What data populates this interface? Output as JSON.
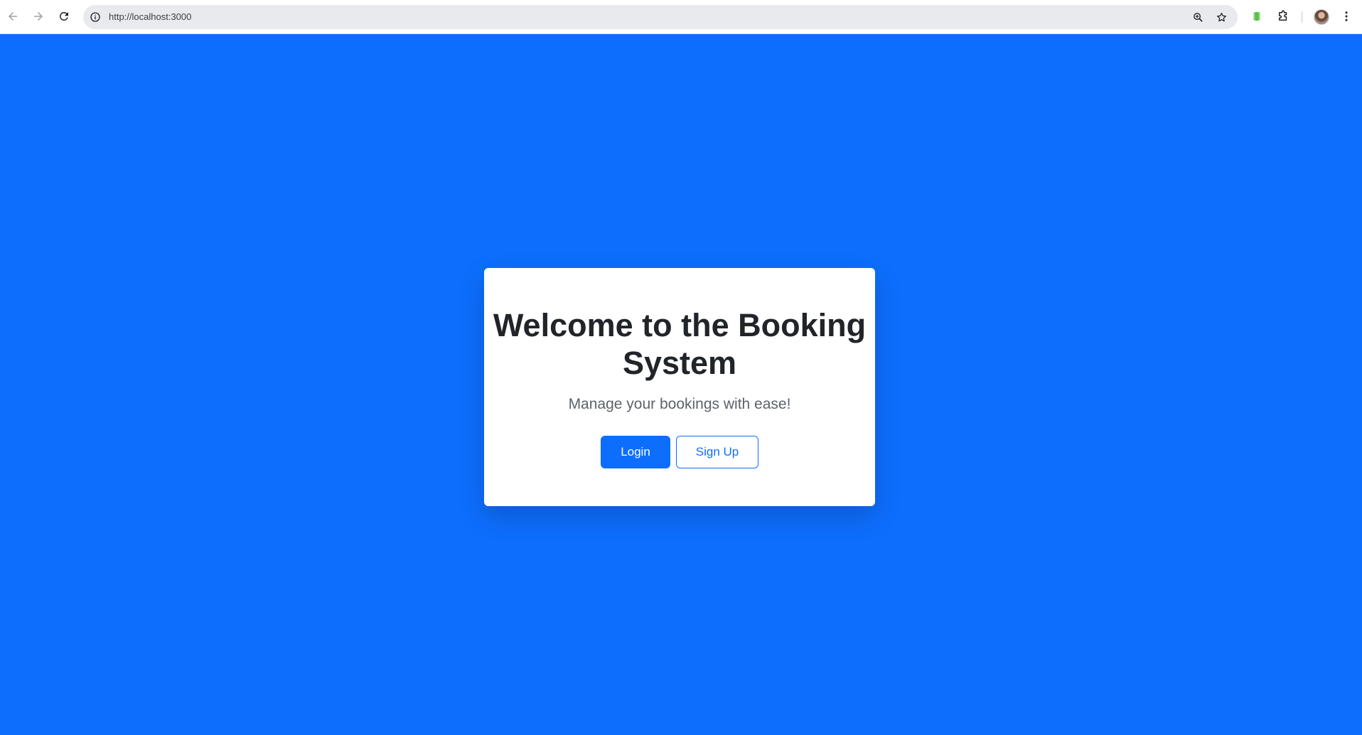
{
  "browser": {
    "url": "http://localhost:3000",
    "icons": {
      "back": "back-arrow-icon",
      "forward": "forward-arrow-icon",
      "reload": "reload-icon",
      "site_info": "info-icon",
      "zoom": "zoom-icon",
      "bookmark": "star-icon",
      "extension": "green-extension-icon",
      "extensions_menu": "puzzle-icon",
      "profile": "avatar",
      "menu": "kebab-menu-icon"
    }
  },
  "page": {
    "background_color": "#0d6efd",
    "card": {
      "title": "Welcome to the Booking System",
      "subtitle": "Manage your bookings with ease!",
      "buttons": {
        "login_label": "Login",
        "signup_label": "Sign Up"
      }
    }
  },
  "colors": {
    "primary": "#0d6efd",
    "title_text": "#212529",
    "subtitle_text": "#5c636a",
    "card_background": "#ffffff"
  }
}
